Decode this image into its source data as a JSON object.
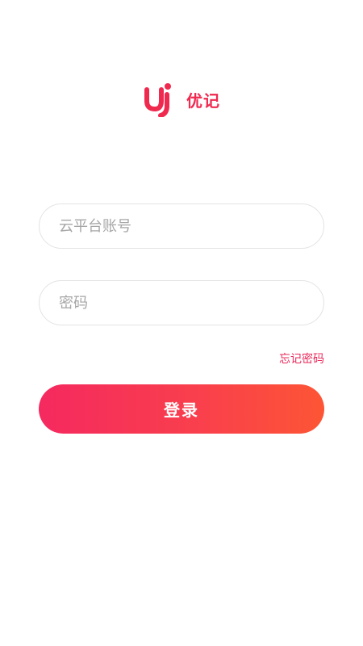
{
  "brand": {
    "logo_icon": "youji-logo-icon",
    "app_name": "优记",
    "accent_color": "#f0294f"
  },
  "form": {
    "account": {
      "value": "",
      "placeholder": "云平台账号"
    },
    "password": {
      "value": "",
      "placeholder": "密码"
    },
    "forgot_password_label": "忘记密码",
    "login_label": "登录",
    "button_gradient": [
      "#f5295f",
      "#fd5535"
    ]
  }
}
